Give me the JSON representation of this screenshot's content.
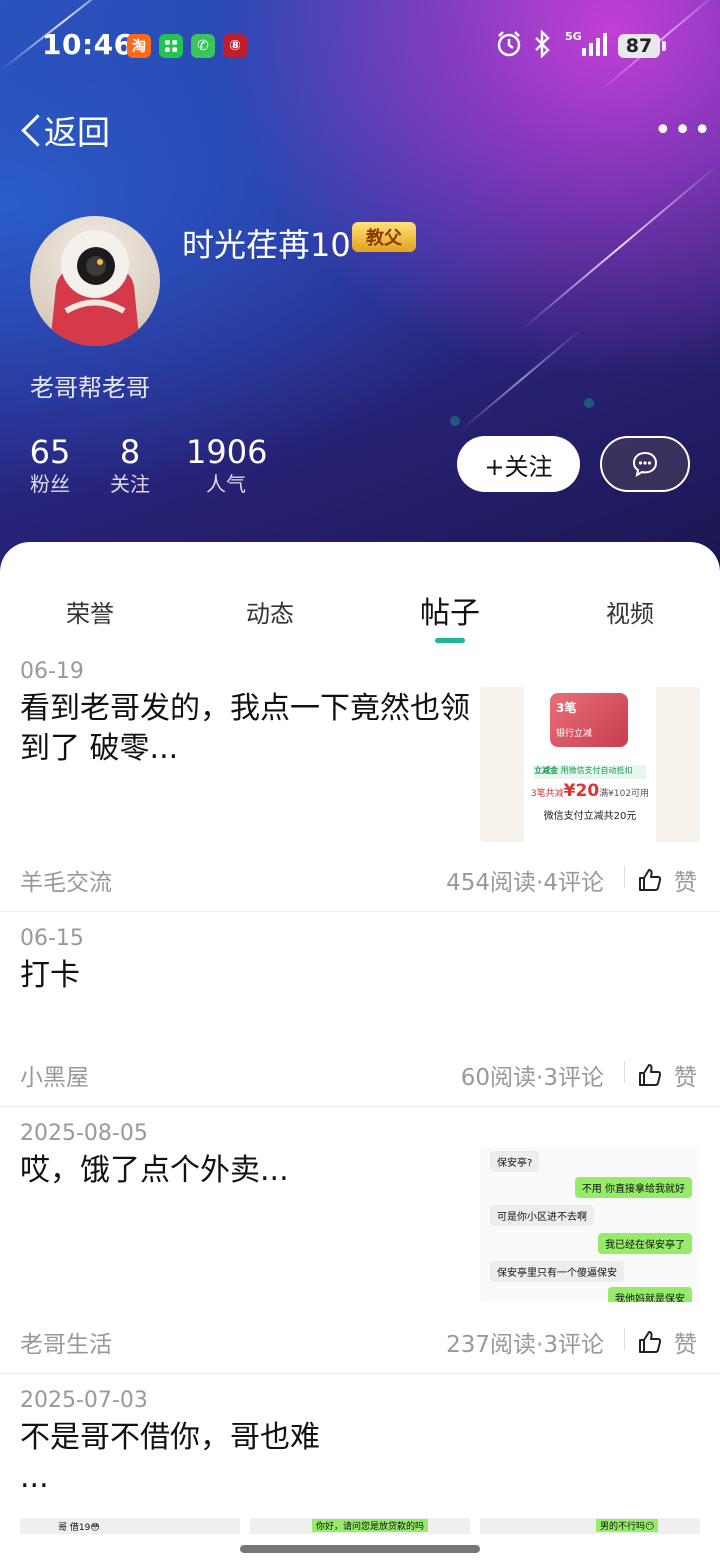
{
  "status_bar": {
    "time": "10:46",
    "apps": [
      "淘",
      "■",
      "✆",
      "⑧"
    ],
    "network": "5G",
    "battery": "87"
  },
  "nav": {
    "back_label": "返回",
    "more_label": "•••"
  },
  "profile": {
    "username": "时光荏苒10",
    "badge": "教父",
    "signature": "老哥帮老哥",
    "stats": [
      {
        "value": "65",
        "label": "粉丝"
      },
      {
        "value": "8",
        "label": "关注"
      },
      {
        "value": "1906",
        "label": "人气"
      }
    ],
    "follow_label": "+关注"
  },
  "tabs": [
    "荣誉",
    "动态",
    "帖子",
    "视频"
  ],
  "active_tab": "帖子",
  "like_label": "赞",
  "posts": [
    {
      "date": "06-19",
      "title": "看到老哥发的，我点一下竟然也领到了 破零...",
      "forum": "羊毛交流",
      "meta": "454阅读·4评论",
      "thumb": {
        "card_num": "3笔",
        "card_text": "银行立减",
        "tag": "立减金",
        "tag_sub": "用微信支付自动抵扣",
        "line1_pre": "3笔共减",
        "amount": "¥20",
        "line1_post": "满¥102可用",
        "line2": "微信支付立减共20元"
      }
    },
    {
      "date": "06-15",
      "title": "打卡",
      "forum": "小黑屋",
      "meta": "60阅读·3评论"
    },
    {
      "date": "2025-08-05",
      "title": "哎，饿了点个外卖...",
      "forum": "老哥生活",
      "meta": "237阅读·3评论",
      "chat": [
        {
          "side": "w",
          "text": "保安亭?"
        },
        {
          "side": "g",
          "text": "不用 你直接拿给我就好"
        },
        {
          "side": "w",
          "text": "可是你小区进不去啊"
        },
        {
          "side": "g",
          "text": "我已经在保安亭了"
        },
        {
          "side": "w",
          "text": "保安亭里只有一个傻逼保安"
        },
        {
          "side": "g",
          "text": "我他妈就是保安"
        }
      ]
    },
    {
      "date": "2025-07-03",
      "title": "不是哥不借你，哥也难",
      "title2": "...",
      "strip": [
        "哥 借19😳",
        "你好，请问您是放贷款的吗",
        "男的不行吗😶"
      ]
    }
  ]
}
